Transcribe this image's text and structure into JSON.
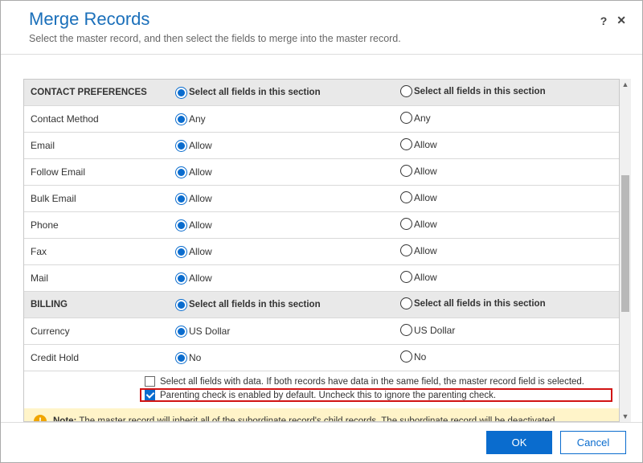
{
  "dialog": {
    "title": "Merge Records",
    "subtitle": "Select the master record, and then select the fields to merge into the master record.",
    "help_icon": "?",
    "close_icon": "✕"
  },
  "select_all_label": "Select all fields in this section",
  "sections": [
    {
      "name": "CONTACT PREFERENCES",
      "master_select_all": true,
      "sub_select_all": false,
      "fields": [
        {
          "label": "Contact Method",
          "master": "Any",
          "sub": "Any",
          "sel": "master"
        },
        {
          "label": "Email",
          "master": "Allow",
          "sub": "Allow",
          "sel": "master"
        },
        {
          "label": "Follow Email",
          "master": "Allow",
          "sub": "Allow",
          "sel": "master"
        },
        {
          "label": "Bulk Email",
          "master": "Allow",
          "sub": "Allow",
          "sel": "master"
        },
        {
          "label": "Phone",
          "master": "Allow",
          "sub": "Allow",
          "sel": "master"
        },
        {
          "label": "Fax",
          "master": "Allow",
          "sub": "Allow",
          "sel": "master"
        },
        {
          "label": "Mail",
          "master": "Allow",
          "sub": "Allow",
          "sel": "master"
        }
      ]
    },
    {
      "name": "BILLING",
      "master_select_all": true,
      "sub_select_all": false,
      "fields": [
        {
          "label": "Currency",
          "master": "US Dollar",
          "sub": "US Dollar",
          "sel": "master"
        },
        {
          "label": "Credit Hold",
          "master": "No",
          "sub": "No",
          "sel": "master"
        }
      ]
    }
  ],
  "options": {
    "select_all_data": {
      "checked": false,
      "label": "Select all fields with data. If both records have data in the same field, the master record field is selected."
    },
    "parenting_check": {
      "checked": true,
      "label": "Parenting check is enabled by default. Uncheck this to ignore the parenting check."
    }
  },
  "note": {
    "prefix": "Note:",
    "text": " The master record will inherit all of the subordinate record's child records. The subordinate record will be deactivated."
  },
  "footer": {
    "ok": "OK",
    "cancel": "Cancel"
  }
}
